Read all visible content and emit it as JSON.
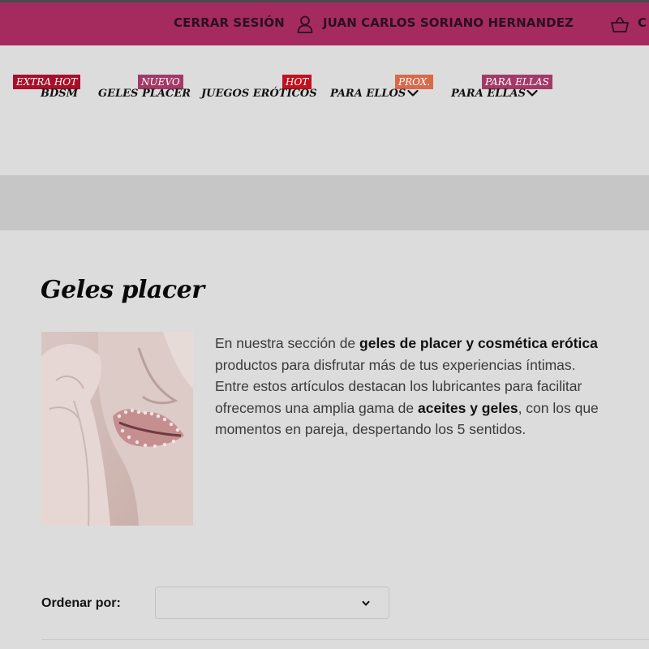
{
  "topbar": {
    "logout_label": "CERRAR SESIÓN",
    "username": "JUAN CARLOS SORIANO HERNANDEZ",
    "cart_label": "C",
    "icons": {
      "user": "user-icon",
      "cart": "basket-icon"
    },
    "bg_color": "#a52b5e"
  },
  "nav": {
    "items": [
      {
        "label": "BDSM",
        "badge": "EXTRA HOT",
        "badge_color": "#a8102a"
      },
      {
        "label": "GELES PLACER",
        "badge": "NUEVO",
        "badge_color": "#a33a66"
      },
      {
        "label": "JUEGOS ERÓTICOS",
        "badge": "HOT",
        "badge_color": "#c2121f"
      },
      {
        "label": "PARA ELLOS",
        "badge": "PROX.",
        "badge_color": "#d66a4a"
      },
      {
        "label": "PARA ELLAS",
        "badge": "PARA ELLAS",
        "badge_color": "#a33a66"
      }
    ]
  },
  "main": {
    "title": "Geles placer",
    "hero_image": "lips-with-rhinestones-photo",
    "description": {
      "l1_pre": "En nuestra sección de ",
      "l1_bold": "geles de placer y cosmética erótica",
      "l2": "productos para disfrutar más de tus experiencias íntimas.",
      "l3": "Entre estos artículos destacan los lubricantes para facilitar",
      "l4_pre": "ofrecemos una amplia gama de ",
      "l4_bold": "aceites y geles",
      "l4_post": ", con los que",
      "l5": "momentos en pareja, despertando los 5 sentidos."
    },
    "sort": {
      "label": "Ordenar por:",
      "selected": ""
    }
  }
}
